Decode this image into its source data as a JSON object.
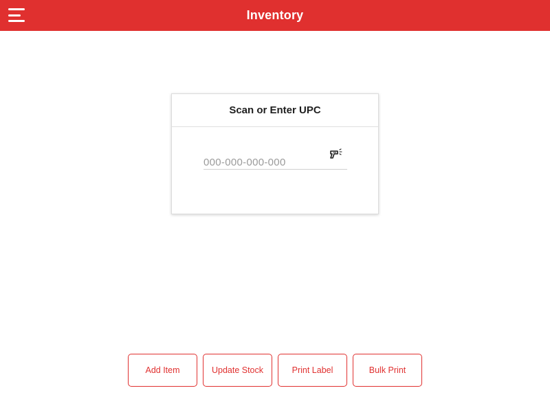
{
  "header": {
    "title": "Inventory",
    "menu_icon": "hamburger-menu-icon",
    "background": "#e0302f"
  },
  "scan_card": {
    "title": "Scan or Enter UPC",
    "upc_input": {
      "value": "",
      "placeholder": "000-000-000-000"
    },
    "scanner_icon": "barcode-scanner-icon"
  },
  "actions": [
    {
      "label": "Add Item"
    },
    {
      "label": "Update Stock"
    },
    {
      "label": "Print Label"
    },
    {
      "label": "Bulk Print"
    }
  ],
  "colors": {
    "accent": "#e0302f",
    "text": "#1e1e1e",
    "placeholder": "#9a9a9a"
  }
}
